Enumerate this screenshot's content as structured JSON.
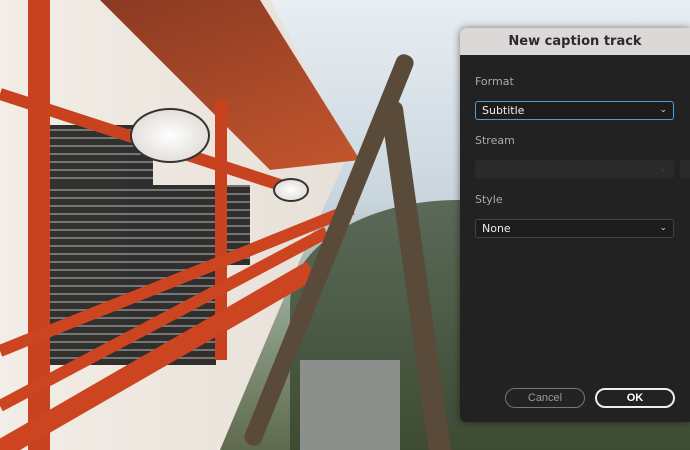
{
  "dialog": {
    "title": "New caption track",
    "format": {
      "label": "Format",
      "value": "Subtitle"
    },
    "stream": {
      "label": "Stream",
      "value": ""
    },
    "style": {
      "label": "Style",
      "value": "None"
    },
    "cancel_label": "Cancel",
    "ok_label": "OK"
  },
  "colors": {
    "focus": "#4a9fd6",
    "titlebar": "#ddd8d8",
    "panel": "#222222"
  }
}
